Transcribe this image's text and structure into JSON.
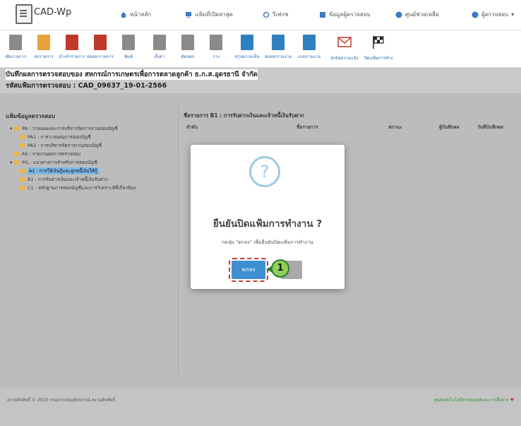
{
  "app": {
    "title": "CAD-Wp"
  },
  "nav": [
    {
      "label": "หน้าหลัก",
      "icon": "home-icon"
    },
    {
      "label": "แฟ้มที่เปิดล่าสุด",
      "icon": "monitor-icon"
    },
    {
      "label": "รีเฟรช",
      "icon": "refresh-icon"
    },
    {
      "label": "ข้อมูลผู้ตรวจสอบ",
      "icon": "person-card-icon"
    },
    {
      "label": "ศูนย์ช่วยเหลือ",
      "icon": "help-icon"
    },
    {
      "label": "ผู้ตรวจสอบ",
      "icon": "user-icon"
    }
  ],
  "toolbar": [
    {
      "label": "เพิ่มรายการ",
      "color": "grey"
    },
    {
      "label": "ลบรายการ",
      "color": "orange"
    },
    {
      "label": "นำเข้ารายการ",
      "color": "red"
    },
    {
      "label": "ส่งออกรายการ",
      "color": "red"
    },
    {
      "label": "พิมพ์",
      "color": "grey"
    },
    {
      "label": "ตั้งค่า",
      "color": "grey"
    },
    {
      "label": "คัดลอก",
      "color": "grey"
    },
    {
      "label": "วาง",
      "color": "grey"
    },
    {
      "label": "สรุปความเห็น",
      "color": "blue"
    },
    {
      "label": "ส่งออกรายงาน",
      "color": "blue"
    },
    {
      "label": "แบบรายงาน",
      "color": "blue"
    },
    {
      "label": "ส่งข้อความแจ้งเตือน",
      "color": "red"
    },
    {
      "label": "ปิดแฟ้มการทำงาน",
      "color": "grey"
    }
  ],
  "page": {
    "heading": "บันทึกผลการตรวจสอบของ สหกรณ์การเกษตรเพื่อการตลาดลูกค้า ธ.ก.ส.อุดรธานี จำกัด",
    "code": "รหัสแฟ้มการตรวจสอบ : CAD_09637_19-01-2566"
  },
  "left_panel": {
    "title": "แฟ้มข้อมูลตรวจสอบ",
    "tree": [
      {
        "label": "PA : วางแผนและการบริหารจัดการงานสอบบัญชี",
        "level": 0,
        "selected": false
      },
      {
        "label": "PA1 : การวางแผนการสอบบัญชี",
        "level": 1,
        "selected": false
      },
      {
        "label": "PA2 : การบริหารจัดการงานสอบบัญชี",
        "level": 1,
        "selected": false
      },
      {
        "label": "AS : รายงานผลการตรวจสอบ",
        "level": 0,
        "selected": false
      },
      {
        "label": "PG : แนวทางการสำหรับการสอบบัญชี",
        "level": 0,
        "selected": false
      },
      {
        "label": "A1 : การให้เงินกู้และลูกหนี้เงินให้กู้",
        "level": 1,
        "selected": true
      },
      {
        "label": "B1 : การรับฝากเงินและเจ้าหนี้เงินรับฝาก",
        "level": 1,
        "selected": false
      },
      {
        "label": "C1 : หลักฐานการสอบบัญชีและการวิเคราะห์ที่เกี่ยวข้อง",
        "level": 1,
        "selected": false
      }
    ]
  },
  "right_panel": {
    "title": "ชื่อรายการ B1 : การรับฝากเงินและเจ้าหนี้เงินรับฝาก",
    "columns": [
      "ลำดับ",
      "ชื่อรายการ",
      "สถานะ",
      "ผู้บันทึกผล",
      "วันที่บันทึกผล"
    ]
  },
  "modal": {
    "icon": "question-icon",
    "title": "ยืนยันปิดแฟ้มการทำงาน ?",
    "text": "กดปุ่ม \"ตกลง\" เพื่อยืนยันปิดแฟ้มการทำงาน",
    "ok_label": "ตกลง",
    "step_number": "1"
  },
  "footer": {
    "copyright": "สงวนลิขสิทธิ์ © 2020 กรมตรวจบัญชีสหกรณ์ สงวนลิขสิทธิ์",
    "link": "ศูนย์เทคโนโลยีสารสนเทศและการสื่อสาร"
  }
}
